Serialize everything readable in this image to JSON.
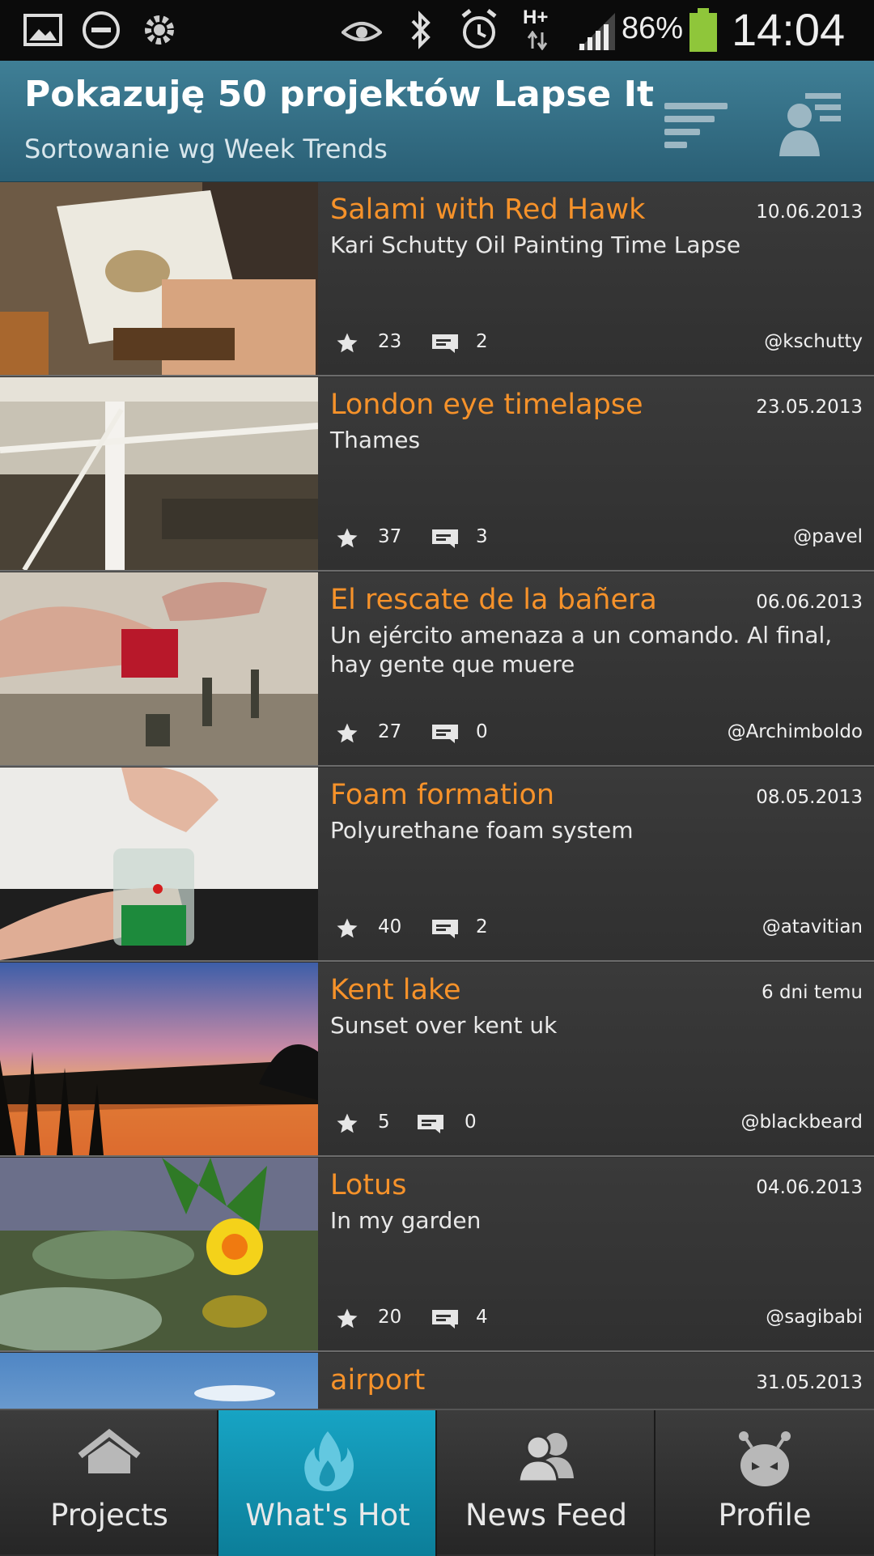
{
  "status_bar": {
    "battery": "86%",
    "time": "14:04",
    "network": "H+",
    "icons": [
      "gallery-icon",
      "do-not-disturb-icon",
      "settings-icon",
      "eye-icon",
      "bluetooth-icon",
      "alarm-icon",
      "signal-icon",
      "battery-icon"
    ]
  },
  "header": {
    "title": "Pokazuję 50 projektów Lapse It",
    "subtitle": "Sortowanie wg Week Trends",
    "sort_icon": "sort-icon",
    "profile_list_icon": "user-list-icon"
  },
  "projects": [
    {
      "title": "Salami with Red Hawk",
      "date": "10.06.2013",
      "description": "Kari Schutty Oil Painting Time Lapse",
      "likes": "23",
      "comments": "2",
      "user": "@kschutty"
    },
    {
      "title": "London eye timelapse",
      "date": "23.05.2013",
      "description": "Thames",
      "likes": "37",
      "comments": "3",
      "user": "@pavel"
    },
    {
      "title": "El rescate de la bañera",
      "date": "06.06.2013",
      "description": "Un ejército amenaza a un comando. Al final, hay gente que muere",
      "likes": "27",
      "comments": "0",
      "user": "@Archimboldo"
    },
    {
      "title": "Foam formation",
      "date": "08.05.2013",
      "description": "Polyurethane foam system",
      "likes": "40",
      "comments": "2",
      "user": "@atavitian"
    },
    {
      "title": "Kent lake",
      "date": "6 dni temu",
      "description": "Sunset over kent uk",
      "likes": "5",
      "comments": "0",
      "user": "@blackbeard"
    },
    {
      "title": "Lotus",
      "date": "04.06.2013",
      "description": "In my garden",
      "likes": "20",
      "comments": "4",
      "user": "@sagibabi"
    },
    {
      "title": "airport",
      "date": "31.05.2013",
      "description": "",
      "likes": "",
      "comments": "",
      "user": ""
    }
  ],
  "bottom_nav": [
    {
      "label": "Projects",
      "icon": "home-icon",
      "active": false
    },
    {
      "label": "What's Hot",
      "icon": "flame-icon",
      "active": true
    },
    {
      "label": "News Feed",
      "icon": "people-icon",
      "active": false
    },
    {
      "label": "Profile",
      "icon": "robot-icon",
      "active": false
    }
  ],
  "colors": {
    "accent": "#f6922a",
    "header": "#3a7890",
    "active_tab": "#139cbb"
  }
}
